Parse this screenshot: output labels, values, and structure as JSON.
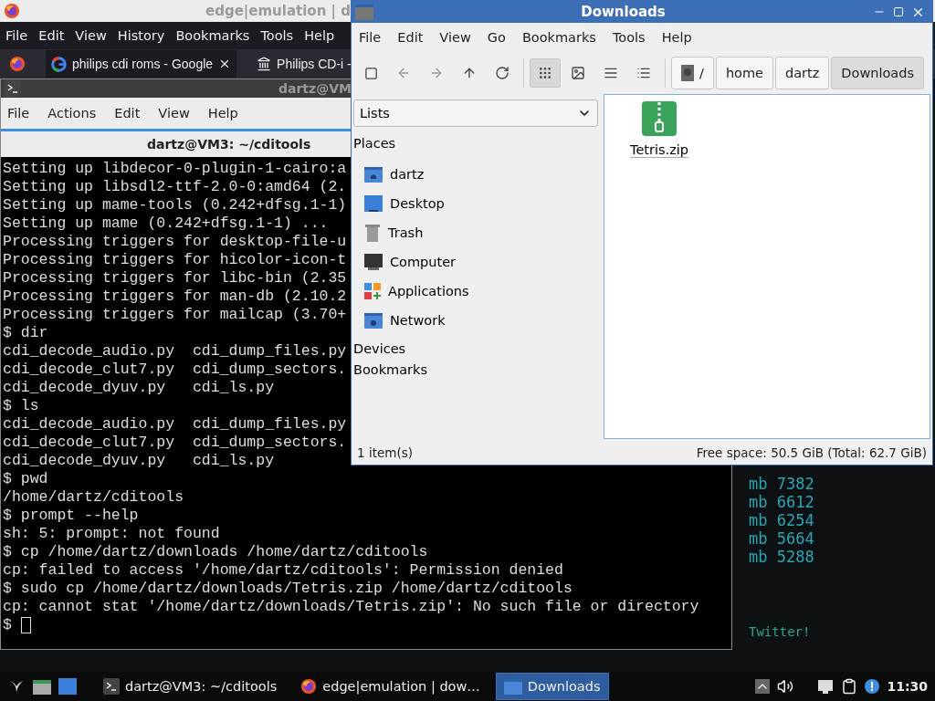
{
  "browser_window": {
    "title": "edge|emulation | d",
    "menu": [
      "File",
      "Edit",
      "View",
      "History",
      "Bookmarks",
      "Tools",
      "Help"
    ],
    "tabs": [
      {
        "label": "philips cdi roms - Google",
        "selected": true,
        "kind": "google"
      },
      {
        "label": "Philips CD-i -",
        "selected": false,
        "kind": "museum"
      }
    ],
    "page_stats": [
      "mb 7382",
      "mb 6612",
      "mb 6254",
      "mb 5664",
      "mb 5288"
    ],
    "page_link": "Twitter!"
  },
  "terminal_window": {
    "title": "dartz@VM",
    "menu": [
      "File",
      "Actions",
      "Edit",
      "View",
      "Help"
    ],
    "tab_title": "dartz@VM3: ~/cditools",
    "lines": [
      "Setting up libdecor-0-plugin-1-cairo:a",
      "Setting up libsdl2-ttf-2.0-0:amd64 (2.",
      "Setting up mame-tools (0.242+dfsg.1-1)",
      "Setting up mame (0.242+dfsg.1-1) ...",
      "Processing triggers for desktop-file-u",
      "Processing triggers for hicolor-icon-t",
      "Processing triggers for libc-bin (2.35",
      "Processing triggers for man-db (2.10.2",
      "Processing triggers for mailcap (3.70+",
      "$ dir",
      "cdi_decode_audio.py  cdi_dump_files.py",
      "cdi_decode_clut7.py  cdi_dump_sectors.",
      "cdi_decode_dyuv.py   cdi_ls.py",
      "$ ls",
      "cdi_decode_audio.py  cdi_dump_files.py",
      "cdi_decode_clut7.py  cdi_dump_sectors.",
      "cdi_decode_dyuv.py   cdi_ls.py",
      "$ pwd",
      "/home/dartz/cditools",
      "$ prompt --help",
      "sh: 5: prompt: not found",
      "$ cp /home/dartz/downloads /home/dartz/cditools",
      "cp: failed to access '/home/dartz/cditools': Permission denied",
      "$ sudo cp /home/dartz/downloads/Tetris.zip /home/dartz/cditools",
      "cp: cannot stat '/home/dartz/downloads/Tetris.zip': No such file or directory"
    ],
    "prompt": "$"
  },
  "file_manager": {
    "title": "Downloads",
    "menu": [
      "File",
      "Edit",
      "View",
      "Go",
      "Bookmarks",
      "Tools",
      "Help"
    ],
    "view_modes": [
      {
        "kind": "icons",
        "selected": true
      },
      {
        "kind": "thumbnails",
        "selected": false
      },
      {
        "kind": "compact",
        "selected": false
      },
      {
        "kind": "list",
        "selected": false
      }
    ],
    "path": [
      {
        "label": "/",
        "kind": "root",
        "selected": false
      },
      {
        "label": "home",
        "kind": "folder",
        "selected": false
      },
      {
        "label": "dartz",
        "kind": "folder",
        "selected": false
      },
      {
        "label": "Downloads",
        "kind": "folder",
        "selected": true
      }
    ],
    "sidebar_mode": "Lists",
    "sections": [
      {
        "heading": "Places",
        "items": [
          {
            "label": "dartz",
            "kind": "home"
          },
          {
            "label": "Desktop",
            "kind": "desktop"
          },
          {
            "label": "Trash",
            "kind": "trash"
          },
          {
            "label": "Computer",
            "kind": "computer"
          },
          {
            "label": "Applications",
            "kind": "apps"
          },
          {
            "label": "Network",
            "kind": "network"
          }
        ]
      },
      {
        "heading": "Devices"
      },
      {
        "heading": "Bookmarks"
      }
    ],
    "files": [
      {
        "name": "Tetris.zip",
        "kind": "zip"
      }
    ],
    "status_count": "1 item(s)",
    "status_space": "Free space: 50.5 GiB (Total: 62.7 GiB)"
  },
  "taskbar": {
    "tasks": [
      {
        "label": "dartz@VM3: ~/cditools",
        "kind": "terminal",
        "selected": false
      },
      {
        "label": "edge|emulation | dow…",
        "kind": "browser",
        "selected": false
      },
      {
        "label": "Downloads",
        "kind": "folder",
        "selected": true
      }
    ],
    "clock": "11:30"
  }
}
